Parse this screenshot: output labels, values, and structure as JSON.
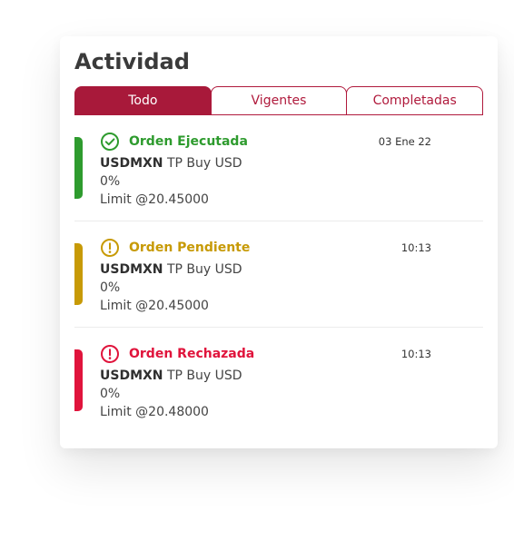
{
  "header": {
    "title": "Actividad"
  },
  "tabs": [
    {
      "label": "Todo",
      "active": true
    },
    {
      "label": "Vigentes",
      "active": false
    },
    {
      "label": "Completadas",
      "active": false
    }
  ],
  "orders": [
    {
      "status": "Orden Ejecutada",
      "status_icon": "check-circle-icon",
      "color": "#2e9b2e",
      "time": "03 Ene 22",
      "symbol": "USDMXN",
      "description": "TP Buy USD",
      "percent": "0%",
      "limit": "Limit @20.45000"
    },
    {
      "status": "Orden Pendiente",
      "status_icon": "alert-circle-icon",
      "color": "#c79a06",
      "time": "10:13",
      "symbol": "USDMXN",
      "description": "TP Buy USD",
      "percent": "0%",
      "limit": "Limit @20.45000"
    },
    {
      "status": "Orden Rechazada",
      "status_icon": "alert-circle-icon",
      "color": "#e0143c",
      "time": "10:13",
      "symbol": "USDMXN",
      "description": "TP Buy USD",
      "percent": "0%",
      "limit": "Limit @20.48000"
    }
  ]
}
